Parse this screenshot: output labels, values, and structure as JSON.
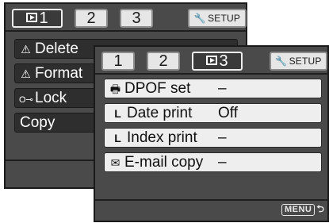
{
  "back_screen": {
    "tabs": [
      {
        "label": "1",
        "icon": "play-icon",
        "active": true
      },
      {
        "label": "2",
        "active": false
      },
      {
        "label": "3",
        "active": false
      }
    ],
    "setup_tab": {
      "label": "SETUP",
      "icon": "wrench-icon"
    },
    "items": [
      {
        "label": "Delete",
        "icon": "warning-icon",
        "glyph": "⚠"
      },
      {
        "label": "Format",
        "icon": "warning-icon",
        "glyph": "⚠"
      },
      {
        "label": "Lock",
        "icon": "key-icon",
        "glyph": "O⊸"
      },
      {
        "label": "Copy",
        "icon": "",
        "glyph": ""
      }
    ]
  },
  "front_screen": {
    "tabs": [
      {
        "label": "1",
        "active": false
      },
      {
        "label": "2",
        "active": false
      },
      {
        "label": "3",
        "icon": "play-icon",
        "active": true
      }
    ],
    "setup_tab": {
      "label": "SETUP",
      "icon": "wrench-icon"
    },
    "items": [
      {
        "label": "DPOF set",
        "value": "–",
        "icon": "printer-icon",
        "glyph": "🖶"
      },
      {
        "label": "Date print",
        "value": "Off",
        "icon": "sub-item-icon",
        "glyph": "L"
      },
      {
        "label": "Index print",
        "value": "–",
        "icon": "sub-item-icon",
        "glyph": "L"
      },
      {
        "label": "E-mail copy",
        "value": "–",
        "icon": "envelope-icon",
        "glyph": "✉"
      }
    ],
    "footer": {
      "menu_label": "MENU",
      "icon": "return-arrow-icon",
      "glyph": "⮌"
    }
  },
  "colors": {
    "screen_bg": "#4a4a4a",
    "row_bg": "#eeeeee",
    "active_tab_bg": "#3a3a3a"
  }
}
